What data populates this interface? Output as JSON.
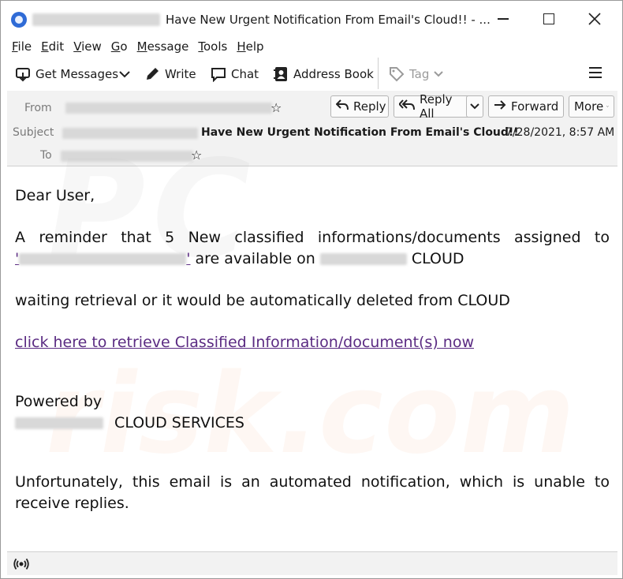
{
  "window": {
    "title": "Have New Urgent Notification From Email's Cloud!! - ...",
    "controls": {
      "minimize": "minimize",
      "maximize": "maximize",
      "close": "close"
    }
  },
  "menu": [
    "File",
    "Edit",
    "View",
    "Go",
    "Message",
    "Tools",
    "Help"
  ],
  "menu_access_keys": [
    "F",
    "E",
    "V",
    "G",
    "M",
    "T",
    "H"
  ],
  "toolbar": {
    "get_messages": "Get Messages",
    "write": "Write",
    "chat": "Chat",
    "address_book": "Address Book",
    "tag": "Tag"
  },
  "header": {
    "from_label": "From",
    "subject_label": "Subject",
    "to_label": "To",
    "subject": "Have New Urgent Notification From Email's Cloud!!",
    "date": "7/28/2021, 8:57 AM",
    "reply": "Reply",
    "reply_all": "Reply All",
    "forward": "Forward",
    "more": "More"
  },
  "body": {
    "greeting": "Dear User,",
    "line1": "A reminder that 5 New classified informations/documents assigned to",
    "line2_mid": "are available on",
    "line2_end": "CLOUD",
    "line3": "waiting retrieval or it would be automatically deleted from CLOUD",
    "link": "click here to retrieve Classified Information/document(s) now",
    "powered_by": "Powered by",
    "cloud_services": "CLOUD SERVICES",
    "footer": "Unfortunately, this email is an automated notification, which is unable to receive replies."
  },
  "colors": {
    "link": "#5a2a82",
    "app_icon": "#2f6bd6",
    "header_bg": "#f2f2f2"
  },
  "icons": [
    "thunderbird-app-icon",
    "get-messages-icon",
    "pencil-icon",
    "chat-bubble-icon",
    "address-book-icon",
    "tag-icon",
    "reply-icon",
    "reply-all-icon",
    "forward-icon",
    "hamburger-menu-icon",
    "star-icon",
    "activity-icon"
  ]
}
